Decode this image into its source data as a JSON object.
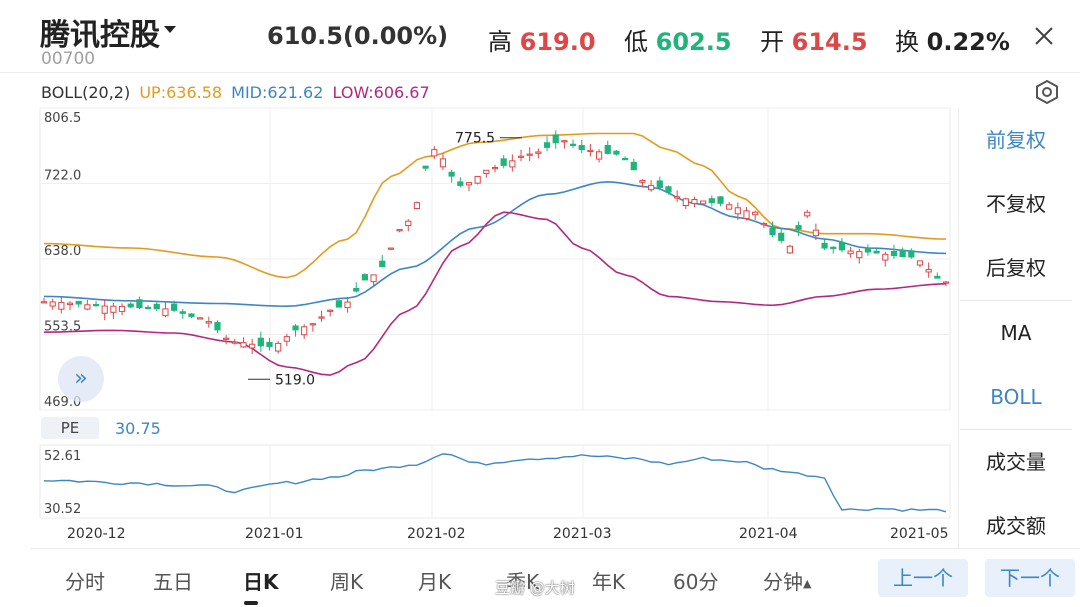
{
  "header": {
    "name": "腾讯控股",
    "code": "00700",
    "price": "610.5(0.00%)",
    "stats": [
      {
        "label": "高",
        "value": "619.0",
        "color": "#e04646"
      },
      {
        "label": "低",
        "value": "602.5",
        "color": "#1fb47a"
      },
      {
        "label": "开",
        "value": "614.5",
        "color": "#e04646"
      },
      {
        "label": "换",
        "value": "0.22%",
        "color": "#222222"
      }
    ]
  },
  "indicator": {
    "name": "BOLL(20,2)",
    "up": "UP:636.58",
    "mid": "MID:621.62",
    "low": "LOW:606.67",
    "colors": {
      "up": "#e39b1f",
      "mid": "#3d86c6",
      "low": "#b3287f"
    }
  },
  "sidebar": {
    "items": [
      "前复权",
      "不复权",
      "后复权",
      "MA",
      "BOLL",
      "成交量",
      "成交额"
    ],
    "active": [
      "前复权",
      "BOLL"
    ]
  },
  "pe": {
    "label": "PE",
    "value": "30.75"
  },
  "chart_data": {
    "type": "candlestick",
    "y_ticks": [
      "806.5",
      "722.0",
      "638.0",
      "553.5",
      "469.0"
    ],
    "ylim": [
      469.0,
      806.5
    ],
    "max_marker": "775.5",
    "min_marker": "519.0",
    "x_ticks": [
      "2020-12",
      "2021-01",
      "2021-02",
      "2021-03",
      "2021-04",
      "2021-05"
    ],
    "pe_ticks": [
      "52.61",
      "30.52"
    ],
    "pe_ylim": [
      30.52,
      52.61
    ],
    "colors": {
      "up": "#e04646",
      "down": "#1fb47a",
      "pe": "#3d86c6"
    }
  },
  "bottom": {
    "tabs": [
      "分时",
      "五日",
      "日K",
      "周K",
      "月K",
      "季K",
      "年K",
      "60分",
      "分钟"
    ],
    "active": "日K",
    "prev": "上一个",
    "next": "下一个"
  },
  "watermark": "豆瓣 @大树"
}
